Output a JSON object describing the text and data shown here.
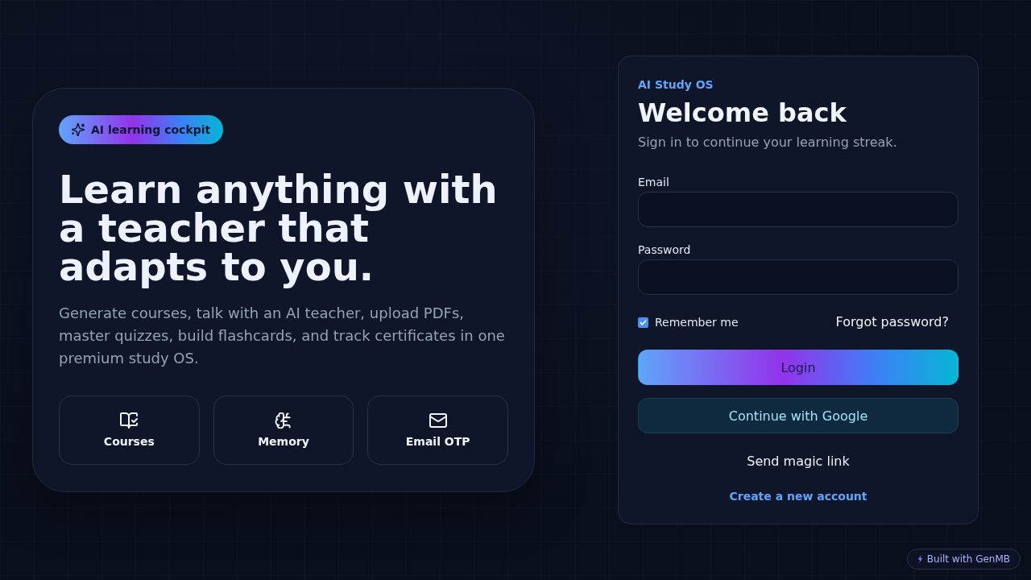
{
  "hero": {
    "badge": {
      "label": "AI learning cockpit"
    },
    "headline": "Learn anything with a teacher that adapts to you.",
    "description": "Generate courses, talk with an AI teacher, upload PDFs, master quizzes, build flashcards, and track certificates in one premium study OS.",
    "features": [
      {
        "label": "Courses",
        "kind": "book"
      },
      {
        "label": "Memory",
        "kind": "brain"
      },
      {
        "label": "Email OTP",
        "kind": "mail"
      }
    ]
  },
  "login": {
    "eyebrow": "AI Study OS",
    "title": "Welcome back",
    "subtitle": "Sign in to continue your learning streak.",
    "fields": [
      {
        "label": "Email"
      },
      {
        "label": "Password"
      }
    ],
    "remember": {
      "label": "Remember me",
      "checked": true
    },
    "forgot_link": "Forgot password?",
    "buttons": [
      {
        "label": "Login",
        "kind": "primary"
      },
      {
        "label": "Continue with Google",
        "kind": "secondary"
      },
      {
        "label": "Send magic link",
        "kind": "plain"
      }
    ],
    "signup_link": "Create a new account"
  },
  "footer_badge": {
    "label": "Built with GenMB"
  }
}
